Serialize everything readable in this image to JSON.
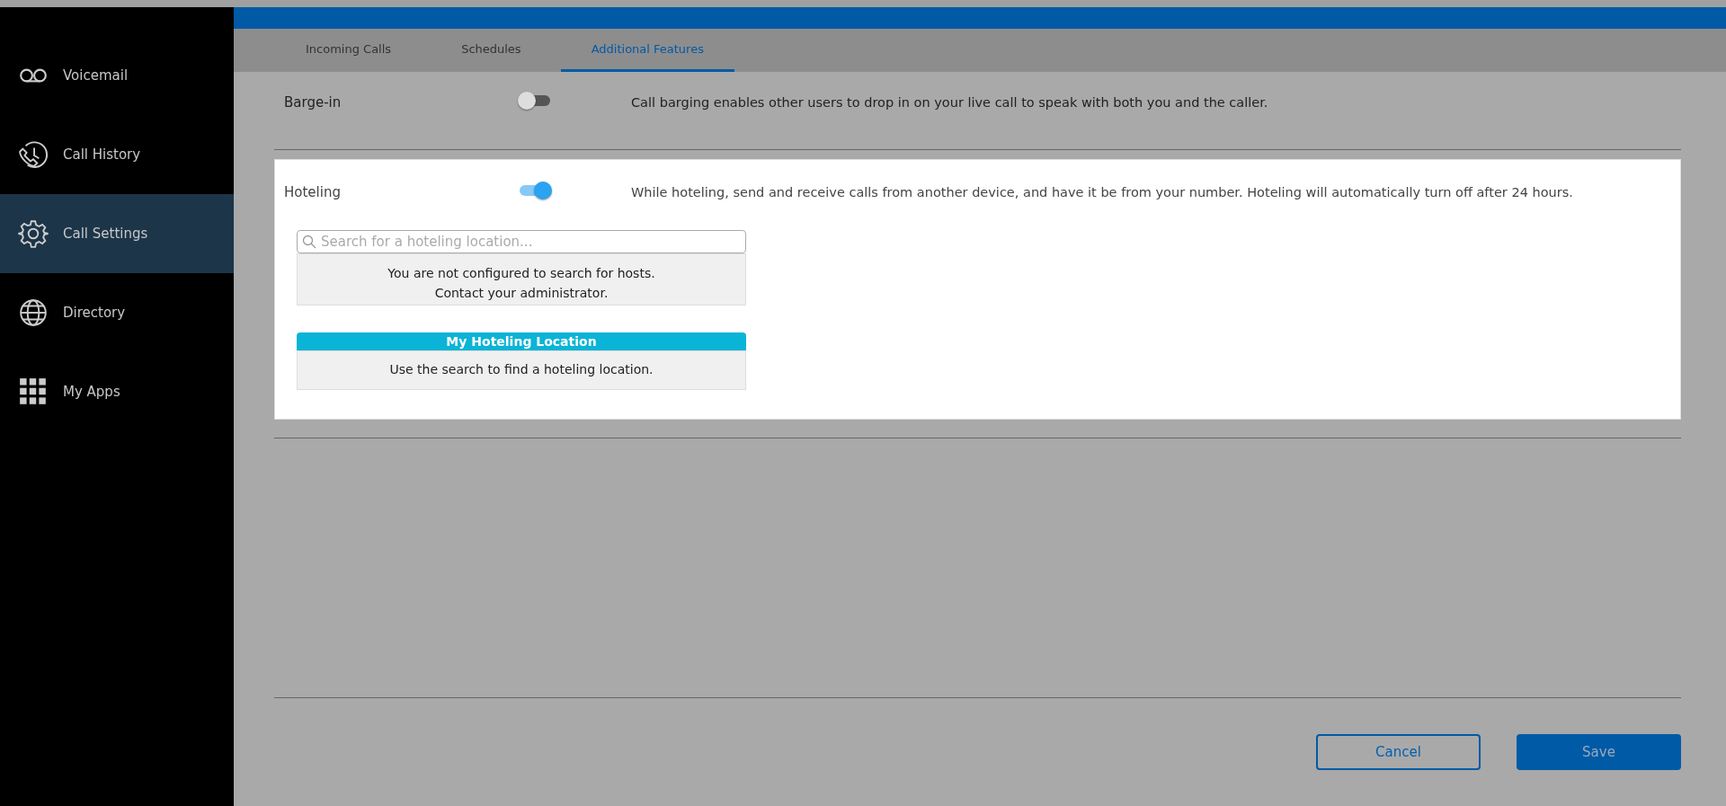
{
  "sidebar": {
    "items": [
      {
        "label": "Voicemail",
        "kind": "voicemail",
        "selected": false
      },
      {
        "label": "Call History",
        "kind": "history",
        "selected": false
      },
      {
        "label": "Call Settings",
        "kind": "settings",
        "selected": true
      },
      {
        "label": "Directory",
        "kind": "directory",
        "selected": false
      },
      {
        "label": "My Apps",
        "kind": "apps",
        "selected": false
      }
    ]
  },
  "tabs": [
    {
      "label": "Incoming Calls",
      "selected": false
    },
    {
      "label": "Schedules",
      "selected": false
    },
    {
      "label": "Additional Features",
      "selected": true
    }
  ],
  "features": [
    {
      "label": "Barge-in",
      "on": false,
      "highlighted": false,
      "description": "Call barging enables other users to drop in on your live call to speak with both you and the caller."
    },
    {
      "label": "Hoteling",
      "on": true,
      "highlighted": true,
      "description": "While hoteling, send and receive calls from another device, and have it be from your number. Hoteling will automatically turn off after 24 hours.",
      "search": {
        "placeholder": "Search for a hoteling location..."
      },
      "notice": [
        "You are not configured to search for hosts.",
        "Contact your administrator."
      ],
      "location": {
        "title": "My Hoteling Location",
        "message": "Use the search to find a hoteling location."
      }
    }
  ],
  "buttons": {
    "cancel": "Cancel",
    "save": "Save"
  }
}
